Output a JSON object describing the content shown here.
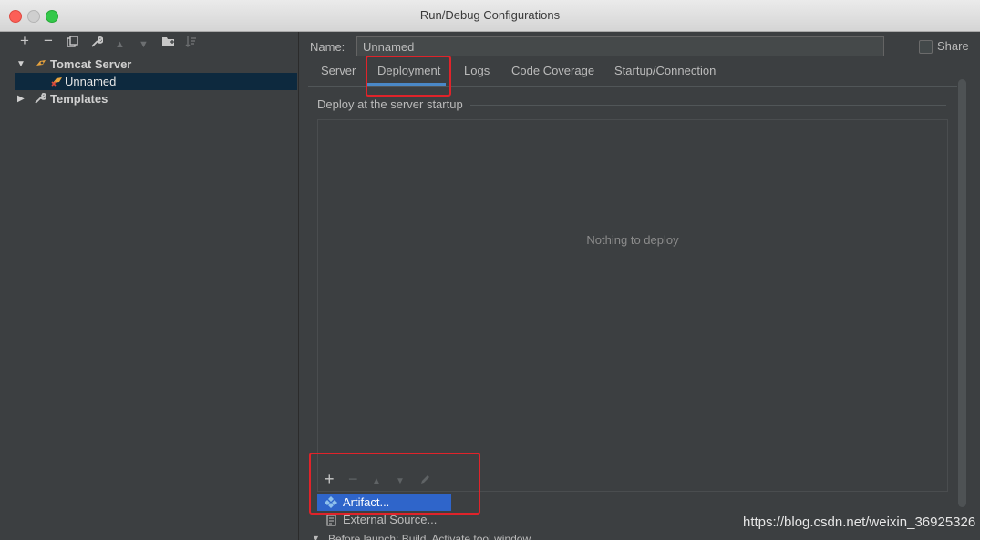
{
  "window": {
    "title": "Run/Debug Configurations"
  },
  "toolbar": {
    "icons": [
      "plus-icon",
      "minus-icon",
      "copy-icon",
      "wrench-icon",
      "arrow-up-icon",
      "arrow-down-icon",
      "folder-icon",
      "sort-icon"
    ]
  },
  "tree": {
    "items": [
      {
        "label": "Tomcat Server",
        "expanded": true
      },
      {
        "label": "Unnamed",
        "selected": true
      },
      {
        "label": "Templates",
        "expanded": false
      }
    ]
  },
  "config": {
    "name_label": "Name:",
    "name_value": "Unnamed",
    "share_label": "Share",
    "share_checked": false
  },
  "tabs": [
    {
      "label": "Server"
    },
    {
      "label": "Deployment",
      "active": true
    },
    {
      "label": "Logs"
    },
    {
      "label": "Code Coverage"
    },
    {
      "label": "Startup/Connection"
    }
  ],
  "deploy": {
    "section_label": "Deploy at the server startup",
    "empty_text": "Nothing to deploy"
  },
  "popup": {
    "items": [
      {
        "label": "Artifact...",
        "selected": true
      },
      {
        "label": "External Source..."
      }
    ]
  },
  "before_launch": {
    "label": "Before launch: Build, Activate tool window"
  },
  "watermark": {
    "text": "https://blog.csdn.net/weixin_36925326"
  },
  "colors": {
    "background": "#3c3f41",
    "selection": "#0d293e",
    "accent": "#4a88c7",
    "popup_selection": "#2f65ca",
    "highlight_box": "#e0232a"
  }
}
